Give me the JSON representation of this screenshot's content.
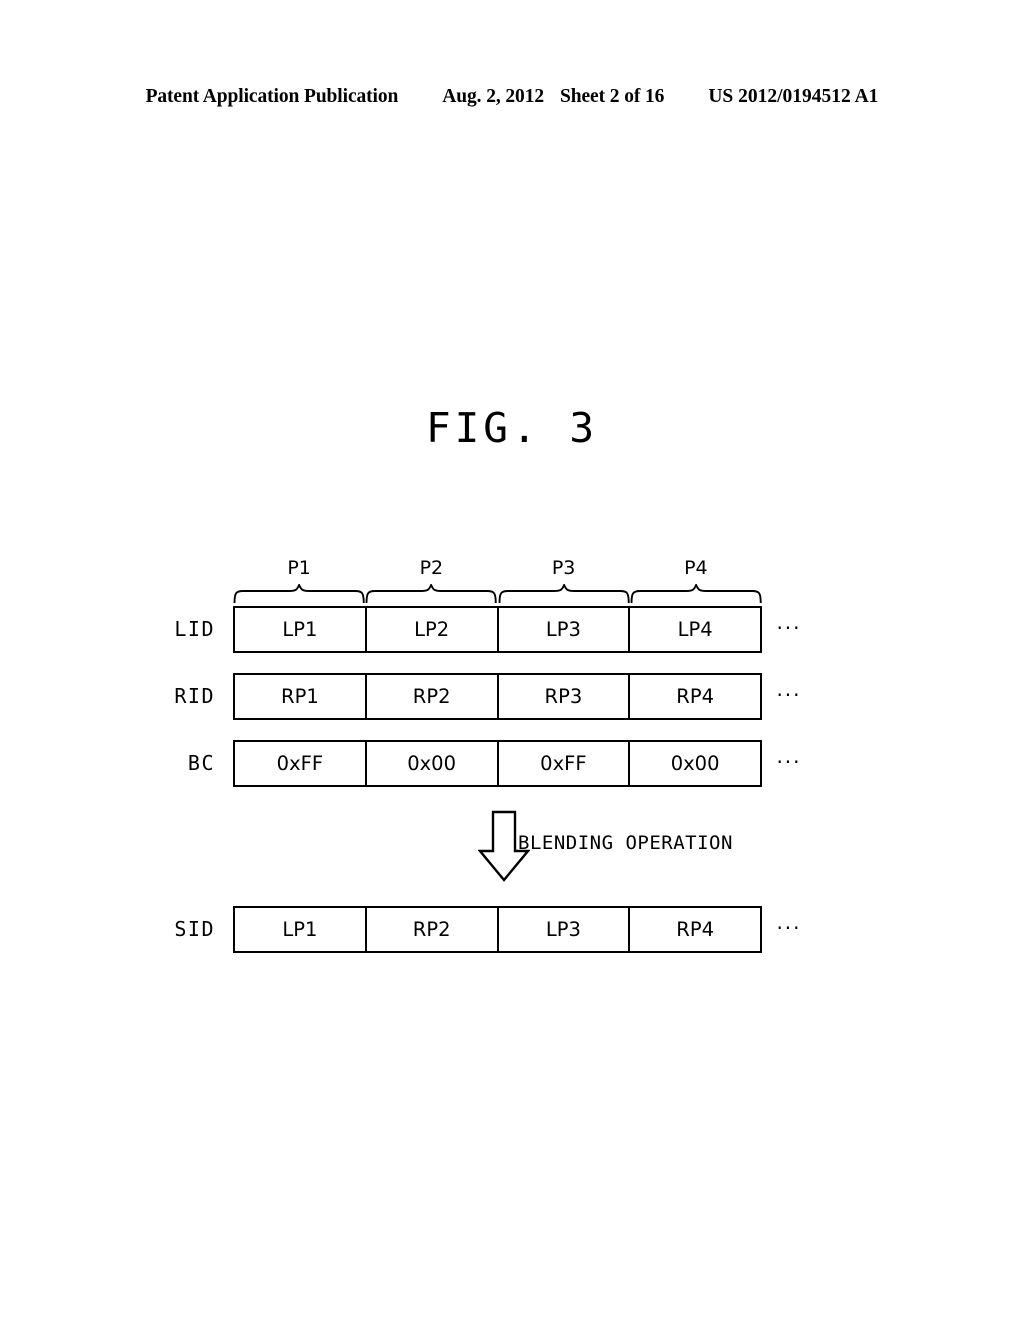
{
  "header": {
    "publication": "Patent Application Publication",
    "date": "Aug. 2, 2012",
    "sheet": "Sheet 2 of 16",
    "document_number": "US 2012/0194512 A1"
  },
  "figure": {
    "title": "FIG. 3",
    "period_labels": [
      "P1",
      "P2",
      "P3",
      "P4"
    ],
    "rows": [
      {
        "label": "LID",
        "cells": [
          "LP1",
          "LP2",
          "LP3",
          "LP4"
        ],
        "continuation": "···"
      },
      {
        "label": "RID",
        "cells": [
          "RP1",
          "RP2",
          "RP3",
          "RP4"
        ],
        "continuation": "···"
      },
      {
        "label": "BC",
        "cells": [
          "0xFF",
          "0x00",
          "0xFF",
          "0x00"
        ],
        "continuation": "···"
      }
    ],
    "operation": {
      "caption": "BLENDING OPERATION",
      "arrow_direction": "down"
    },
    "result_row": {
      "label": "SID",
      "cells": [
        "LP1",
        "RP2",
        "LP3",
        "RP4"
      ],
      "continuation": "···"
    }
  }
}
